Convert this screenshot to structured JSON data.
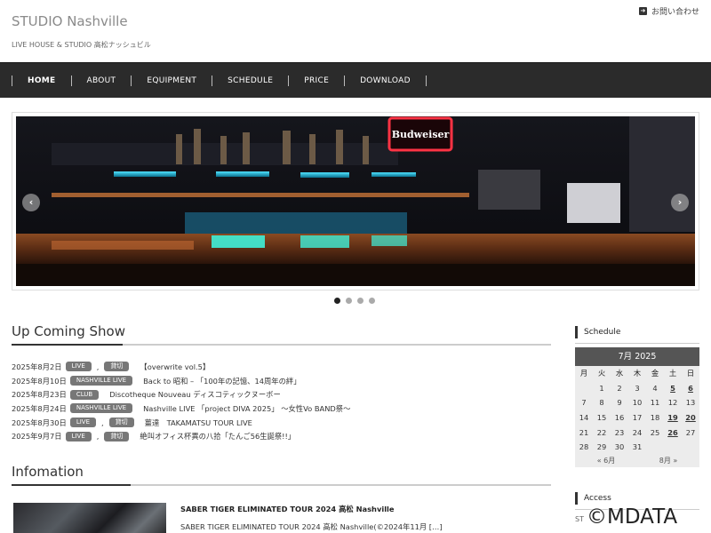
{
  "header": {
    "title": "STUDIO Nashville",
    "description": "LIVE HOUSE & STUDIO 高松ナッシュビル",
    "contact_icon": "arrow-square-icon",
    "contact_label": "お問い合わせ"
  },
  "nav": [
    {
      "label": "HOME",
      "active": true
    },
    {
      "label": "ABOUT"
    },
    {
      "label": "EQUIPMENT"
    },
    {
      "label": "SCHEDULE"
    },
    {
      "label": "PRICE"
    },
    {
      "label": "DOWNLOAD"
    }
  ],
  "slider": {
    "sign_text": "Budweiser",
    "prev_icon": "chevron-left-icon",
    "next_icon": "chevron-right-icon",
    "slide_count": 4,
    "active_index": 0
  },
  "upcoming": {
    "heading": "Up Coming Show",
    "shows": [
      {
        "date": "2025年8月2日",
        "badges": [
          "LIVE",
          "貸切"
        ],
        "title": "【overwrite vol.5】"
      },
      {
        "date": "2025年8月10日",
        "badges": [
          "NASHVILLE LIVE"
        ],
        "title": "Back to 昭和 – 「100年の記憶、14周年の絆」"
      },
      {
        "date": "2025年8月23日",
        "badges": [
          "CLUB"
        ],
        "title": "Discotheque Nouveau ディスコティックヌーボー"
      },
      {
        "date": "2025年8月24日",
        "badges": [
          "NASHVILLE LIVE"
        ],
        "title": "Nashville LIVE 「project DIVA 2025」 ～女性Vo BAND祭～"
      },
      {
        "date": "2025年8月30日",
        "badges": [
          "LIVE",
          "貸切"
        ],
        "title": "薑達　TAKAMATSU TOUR LIVE"
      },
      {
        "date": "2025年9月7日",
        "badges": [
          "LIVE",
          "貸切"
        ],
        "title": "絶叫オフィス杯異の八拾「たんご56生誕祭!!」"
      }
    ]
  },
  "information": {
    "heading": "Infomation",
    "items": [
      {
        "title": "SABER TIGER ELIMINATED TOUR 2024 高松 Nashville",
        "excerpt": "SABER TIGER ELIMINATED TOUR 2024 高松 Nashville(©2024年11月 […]"
      }
    ]
  },
  "sidebar": {
    "schedule_heading": "Schedule",
    "calendar": {
      "caption": "7月 2025",
      "weekdays": [
        "月",
        "火",
        "水",
        "木",
        "金",
        "土",
        "日"
      ],
      "weeks": [
        [
          "",
          "1",
          "2",
          "3",
          "4",
          "5",
          "6"
        ],
        [
          "7",
          "8",
          "9",
          "10",
          "11",
          "12",
          "13"
        ],
        [
          "14",
          "15",
          "16",
          "17",
          "18",
          "19",
          "20"
        ],
        [
          "21",
          "22",
          "23",
          "24",
          "25",
          "26",
          "27"
        ],
        [
          "28",
          "29",
          "30",
          "31",
          "",
          "",
          ""
        ]
      ],
      "linked_days": [
        "5",
        "6",
        "19",
        "20",
        "26"
      ],
      "prev": "« 6月",
      "next": "8月 »"
    },
    "access_heading": "Access",
    "access_text": "ST"
  },
  "watermark": "©MDATA"
}
